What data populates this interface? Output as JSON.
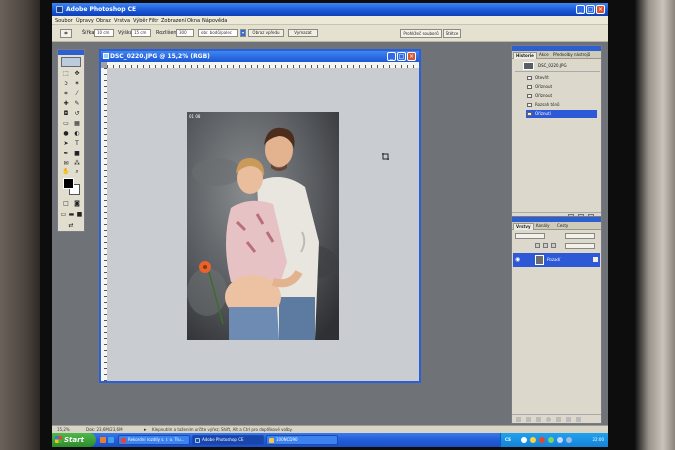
{
  "window": {
    "title": "Adobe Photoshop CE",
    "controls": [
      "_",
      "□",
      "×"
    ]
  },
  "menu": [
    "Soubor",
    "Úpravy",
    "Obraz",
    "Vrstva",
    "Výběr",
    "Filtr",
    "Zobrazení",
    "Okna",
    "Nápověda"
  ],
  "options_bar": {
    "width_label": "Šířka:",
    "width_value": "10 cm",
    "height_label": "Výška:",
    "height_value": "15 cm",
    "resolution_label": "Rozlišení:",
    "resolution_value": "300",
    "unit_value": "obr. bodů/palec",
    "front_image_button": "Obraz vpředu",
    "clear_button": "Vymazat",
    "palette_well_tabs": [
      "Prohlížeč souborů",
      "Štětce"
    ]
  },
  "document": {
    "title": "DSC_0220.JPG @ 15,2% (RGB)",
    "photo_badge": "01 08"
  },
  "history_panel": {
    "tabs": [
      "Historie",
      "Akce",
      "Předvolby nástrojů"
    ],
    "snapshot": "DSC_0220.JPG",
    "items": [
      {
        "label": "Otevřít",
        "selected": false
      },
      {
        "label": "Oříznout",
        "selected": false
      },
      {
        "label": "Oříznout",
        "selected": false
      },
      {
        "label": "Rozsah tónů",
        "selected": false
      },
      {
        "label": "Oříznutí",
        "selected": true
      }
    ]
  },
  "layers_panel": {
    "tabs": [
      "Vrstvy",
      "Kanály",
      "Cesty"
    ],
    "layer_name": "Pozadí"
  },
  "status_bar": {
    "zoom": "15,2%",
    "doc_info": "Dok: 23,6M/23,6M",
    "hint": "Klepnutím a tažením určíte výřez; Shift, Alt a Ctrl pro doplňkové volby."
  },
  "taskbar": {
    "start_label": "Start",
    "tasks": [
      {
        "label": "Rekordní rozdíly s. r. o. Tru...",
        "active": false
      },
      {
        "label": "Adobe Photoshop CE",
        "active": true
      },
      {
        "label": "100NCD90",
        "active": false
      }
    ],
    "lang": "CS",
    "clock": "22:00"
  },
  "colors": {
    "xp_blue": "#245edb",
    "selection_blue": "#2d58d6",
    "start_green": "#3a9a36",
    "panel_grey": "#dcd9cc"
  }
}
